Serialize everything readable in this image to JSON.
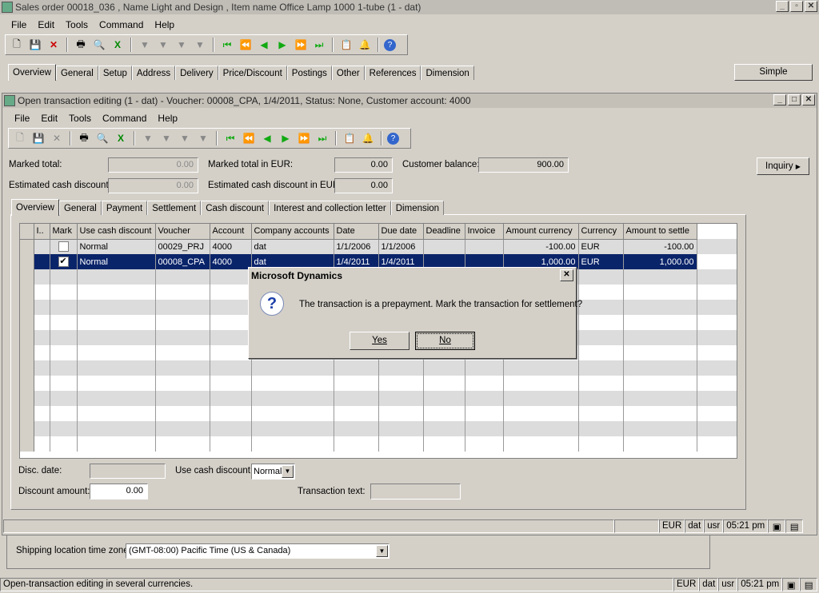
{
  "sales_window": {
    "title": "Sales order 00018_036 , Name Light and Design , Item name Office Lamp 1000 1-tube (1 - dat)",
    "menu": [
      "File",
      "Edit",
      "Tools",
      "Command",
      "Help"
    ],
    "tabs": [
      "Overview",
      "General",
      "Setup",
      "Address",
      "Delivery",
      "Price/Discount",
      "Postings",
      "Other",
      "References",
      "Dimension"
    ],
    "simple_button": "Simple",
    "shipping_tz_label": "Shipping location time zone:",
    "shipping_tz_value": "(GMT-08:00) Pacific Time (US & Canada)"
  },
  "open_window": {
    "title": "Open transaction editing (1 - dat) - Voucher: 00008_CPA, 1/4/2011, Status: None, Customer account: 4000",
    "menu": [
      "File",
      "Edit",
      "Tools",
      "Command",
      "Help"
    ],
    "marked_total_label": "Marked total:",
    "marked_total_value": "0.00",
    "est_cash_disc_label": "Estimated cash discount:",
    "est_cash_disc_value": "0.00",
    "marked_total_eur_label": "Marked total in EUR:",
    "marked_total_eur_value": "0.00",
    "est_cash_disc_eur_label": "Estimated cash discount in EUR:",
    "est_cash_disc_eur_value": "0.00",
    "customer_balance_label": "Customer balance:",
    "customer_balance_value": "900.00",
    "inquiry_button": "Inquiry",
    "tabs": [
      "Overview",
      "General",
      "Payment",
      "Settlement",
      "Cash discount",
      "Interest and collection letter",
      "Dimension"
    ],
    "columns": [
      "I..",
      "Mark",
      "Use cash discount",
      "Voucher",
      "Account",
      "Company accounts",
      "Date",
      "Due date",
      "Deadline",
      "Invoice",
      "Amount currency",
      "Currency",
      "Amount to settle"
    ],
    "rows": [
      {
        "mark": false,
        "use_cash_discount": "Normal",
        "voucher": "00029_PRJ",
        "account": "4000",
        "company": "dat",
        "date": "1/1/2006",
        "due_date": "1/1/2006",
        "deadline": "",
        "invoice": "",
        "amount_currency": "-100.00",
        "currency": "EUR",
        "amount_to_settle": "-100.00"
      },
      {
        "mark": true,
        "use_cash_discount": "Normal",
        "voucher": "00008_CPA",
        "account": "4000",
        "company": "dat",
        "date": "1/4/2011",
        "due_date": "1/4/2011",
        "deadline": "",
        "invoice": "",
        "amount_currency": "1,000.00",
        "currency": "EUR",
        "amount_to_settle": "1,000.00"
      }
    ],
    "disc_date_label": "Disc. date:",
    "disc_date_value": "",
    "use_cash_discount_label": "Use cash discount:",
    "use_cash_discount_value": "Normal",
    "discount_amount_label": "Discount amount:",
    "discount_amount_value": "0.00",
    "transaction_text_label": "Transaction text:",
    "transaction_text_value": "",
    "status": {
      "currency": "EUR",
      "company": "dat",
      "user": "usr",
      "time": "05:21 pm"
    }
  },
  "dialog": {
    "title": "Microsoft Dynamics",
    "message": "The transaction is a prepayment. Mark the transaction for settlement?",
    "yes": "Yes",
    "no": "No"
  },
  "main_status": {
    "text": "Open-transaction editing in several currencies.",
    "currency": "EUR",
    "company": "dat",
    "user": "usr",
    "time": "05:21 pm"
  }
}
